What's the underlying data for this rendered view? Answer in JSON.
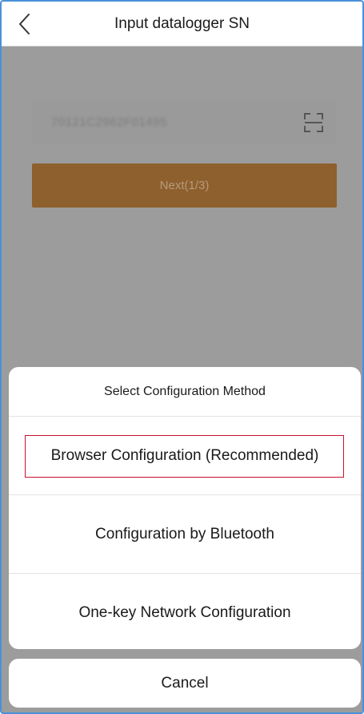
{
  "header": {
    "title": "Input datalogger SN",
    "back_icon": "chevron-left-icon"
  },
  "form": {
    "sn_value": "70121C2962F01495",
    "scan_icon": "scan-icon",
    "next_label": "Next(1/3)"
  },
  "action_sheet": {
    "title": "Select Configuration Method",
    "options": [
      {
        "label": "Browser Configuration (Recommended)",
        "highlighted": true
      },
      {
        "label": "Configuration by Bluetooth",
        "highlighted": false
      },
      {
        "label": "One-key Network Configuration",
        "highlighted": false
      }
    ],
    "cancel_label": "Cancel"
  },
  "colors": {
    "accent_next": "#8e602d",
    "highlight_border": "#c8102e",
    "frame_border": "#4a90d9"
  }
}
